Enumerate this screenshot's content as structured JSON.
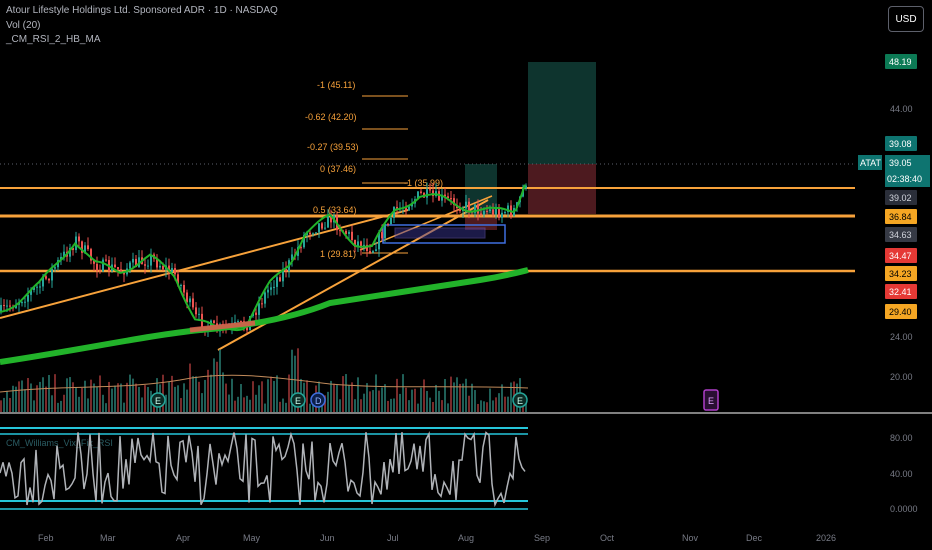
{
  "header": {
    "title": "Atour Lifestyle Holdings Ltd. Sponsored ADR · 1D · NASDAQ",
    "indicator1": "Vol (20)",
    "indicator2": "_CM_RSI_2_HB_MA",
    "currency_button": "USD"
  },
  "oscillator": {
    "legend": "CM_Williams_Vix_Fix_RSI"
  },
  "symbol": {
    "ticker": "ATAT",
    "price": "39.05",
    "countdown": "02:38:40"
  },
  "price_axis": {
    "ticks": [
      "44.00",
      "24.00",
      "20.00"
    ],
    "osc_ticks": [
      "80.00",
      "40.00",
      "0.0000"
    ]
  },
  "price_labels": [
    {
      "text": "48.19",
      "bg": "#0c7a55",
      "fg": "#ffffff"
    },
    {
      "text": "39.08",
      "bg": "#0e7470",
      "fg": "#ffffff"
    },
    {
      "text": "39.02",
      "bg": "#2a2e39",
      "fg": "#d1d4dc"
    },
    {
      "text": "36.84",
      "bg": "#f5a623",
      "fg": "#000000"
    },
    {
      "text": "34.63",
      "bg": "#363a45",
      "fg": "#d1d4dc"
    },
    {
      "text": "34.47",
      "bg": "#e53935",
      "fg": "#ffffff"
    },
    {
      "text": "34.23",
      "bg": "#f5a623",
      "fg": "#000000"
    },
    {
      "text": "32.41",
      "bg": "#e53935",
      "fg": "#ffffff"
    },
    {
      "text": "29.40",
      "bg": "#f5a623",
      "fg": "#000000"
    }
  ],
  "fib_labels": [
    "-1 (45.11)",
    "-0.62 (42.20)",
    "-0.27 (39.53)",
    "0 (37.46)",
    "0.5 (33.64)",
    "1 (29.81)",
    "-1 (35.99)"
  ],
  "time_axis": [
    "Feb",
    "Mar",
    "Apr",
    "May",
    "Jun",
    "Jul",
    "Aug",
    "Sep",
    "Oct",
    "Nov",
    "Dec",
    "2026"
  ],
  "earnings_marker": "E",
  "dividend_marker": "D",
  "colors": {
    "up": "#26a69a",
    "down": "#ef5350",
    "ma_green": "#22b32a",
    "orange": "#f7a23b",
    "rsi_band": "#26c6da"
  }
}
